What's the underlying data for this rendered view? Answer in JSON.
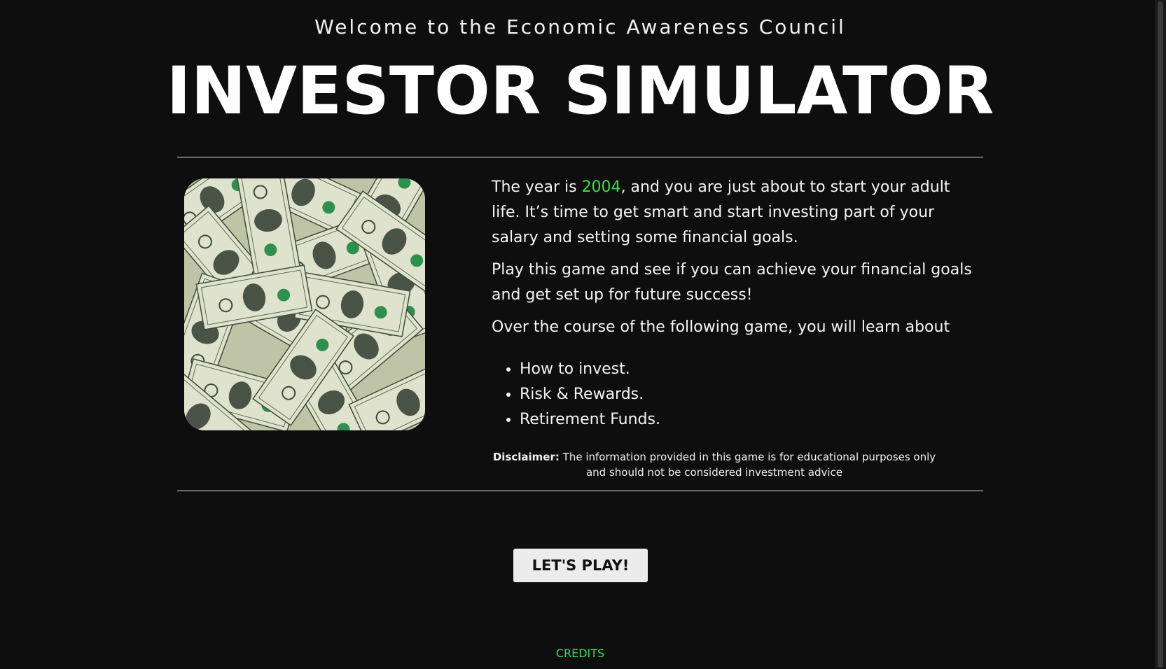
{
  "header": {
    "welcome": "Welcome to the Economic Awareness Council",
    "title": "INVESTOR SIMULATOR"
  },
  "intro": {
    "p1_before": "The year is ",
    "year": "2004",
    "p1_after": ", and you are just about to start your adult life. It’s time to get smart and start investing part of your salary and setting some financial goals.",
    "p2": "Play this game and see if you can achieve your financial goals and get set up for future success!",
    "p3": "Over the course of the following game, you will learn about",
    "learn_items": [
      "How to invest.",
      "Risk & Rewards.",
      "Retirement Funds."
    ]
  },
  "disclaimer": {
    "label": "Disclaimer:",
    "text": " The information provided in this game is for educational purposes only and should not be considered investment advice"
  },
  "actions": {
    "play_label": "LET'S PLAY!",
    "credits_label": "CREDITS"
  },
  "image": {
    "subject": "pile of US one-dollar bills"
  },
  "colors": {
    "background": "#0e0e0e",
    "accent_green": "#3ddc4a",
    "button_bg": "#ececec"
  }
}
